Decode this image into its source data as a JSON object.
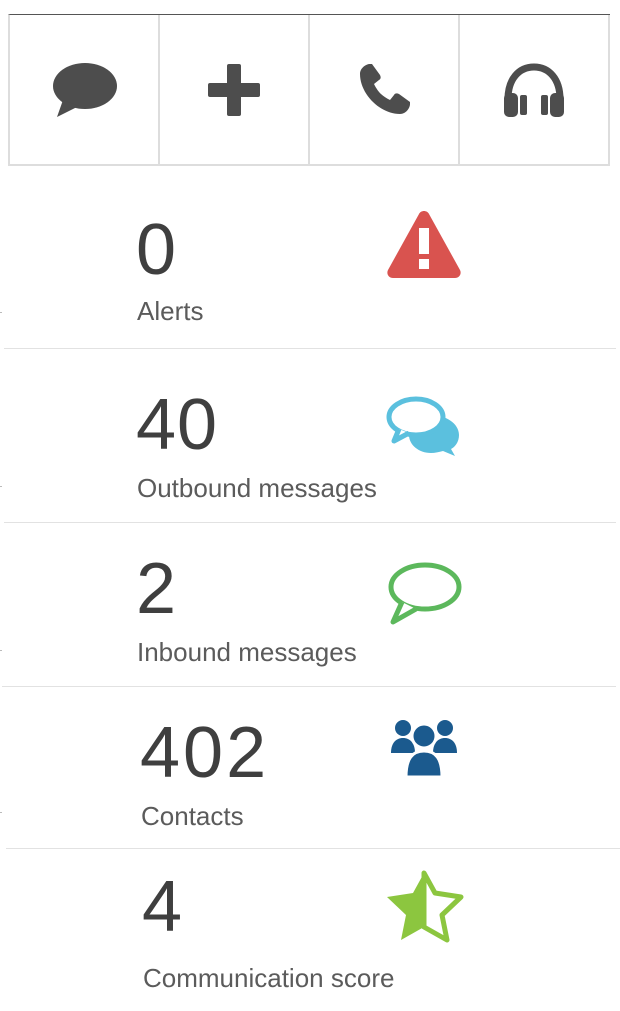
{
  "toolbar": {
    "buttons": [
      {
        "name": "message",
        "icon": "speech-bubble-icon"
      },
      {
        "name": "add",
        "icon": "plus-icon"
      },
      {
        "name": "call",
        "icon": "phone-icon"
      },
      {
        "name": "support",
        "icon": "headphones-icon"
      }
    ]
  },
  "stats": {
    "alerts": {
      "value": "0",
      "label": "Alerts",
      "icon": "warning-icon",
      "color": "#d9534f"
    },
    "outbound": {
      "value": "40",
      "label": "Outbound messages",
      "icon": "chat-bubbles-icon",
      "color": "#5bc0de"
    },
    "inbound": {
      "value": "2",
      "label": "Inbound messages",
      "icon": "speech-bubble-outline-icon",
      "color": "#5cb85c"
    },
    "contacts": {
      "value": "402",
      "label": "Contacts",
      "icon": "users-icon",
      "color": "#1b5a8e"
    },
    "score": {
      "value": "4",
      "label": "Communication score",
      "icon": "half-star-icon",
      "color": "#8cc63f"
    }
  },
  "colors": {
    "icon_dark": "#4d4d4d",
    "divider": "#e2e2e2"
  }
}
